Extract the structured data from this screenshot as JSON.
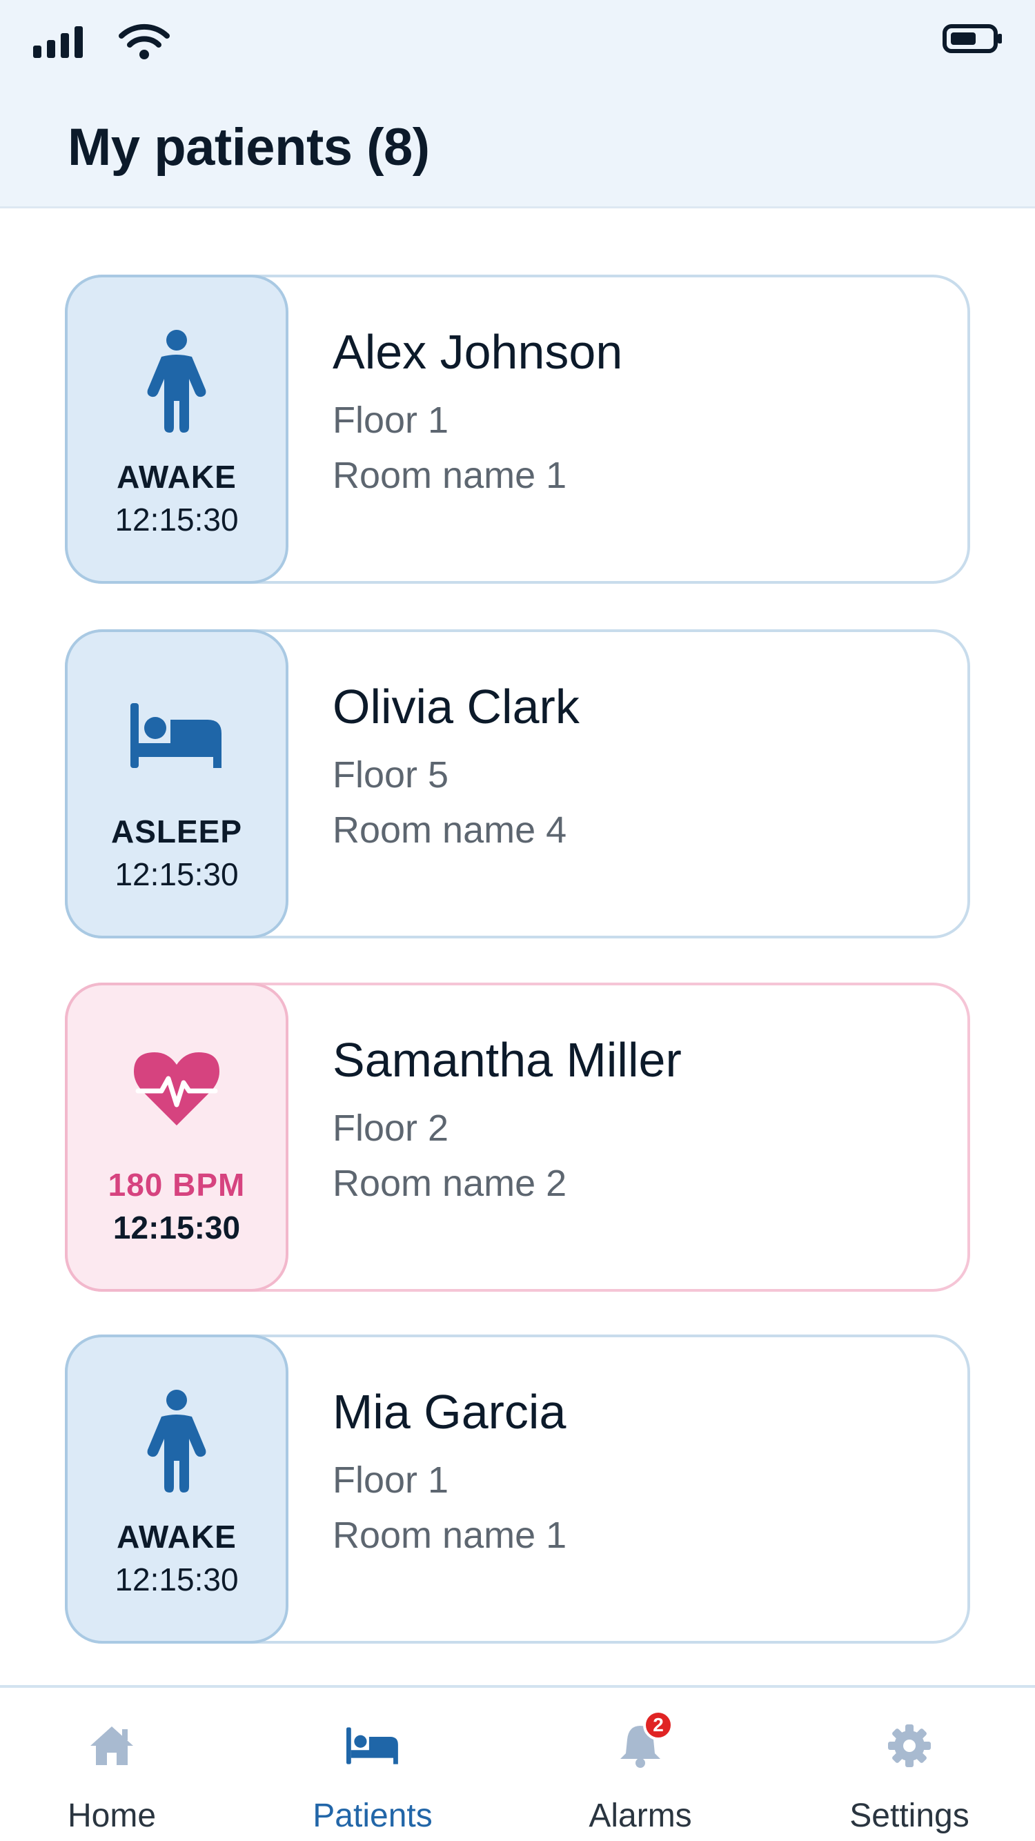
{
  "colors": {
    "header_bg": "#edf4fb",
    "tile_blue": "#dceaf7",
    "tile_pink": "#fce9f0",
    "icon_blue": "#1f66a8",
    "alert_pink": "#d6437f",
    "nav_inactive": "#a8bad0",
    "badge_red": "#e02424"
  },
  "status_bar": {
    "signal": "cellular-signal-icon",
    "wifi": "wifi-icon",
    "battery": "battery-icon"
  },
  "page": {
    "title": "My patients (8)"
  },
  "patients": [
    {
      "name": "Alex Johnson",
      "floor": "Floor 1",
      "room": "Room name 1",
      "status": "AWAKE",
      "time": "12:15:30",
      "icon": "person-icon"
    },
    {
      "name": "Olivia Clark",
      "floor": "Floor 5",
      "room": "Room name 4",
      "status": "ASLEEP",
      "time": "12:15:30",
      "icon": "bed-icon"
    },
    {
      "name": "Samantha Miller",
      "floor": "Floor 2",
      "room": "Room name 2",
      "status": "180 BPM",
      "time": "12:15:30",
      "icon": "heart-pulse-icon"
    },
    {
      "name": "Mia Garcia",
      "floor": "Floor 1",
      "room": "Room name 1",
      "status": "AWAKE",
      "time": "12:15:30",
      "icon": "person-icon"
    }
  ],
  "nav": {
    "items": [
      {
        "label": "Home",
        "icon": "home-icon"
      },
      {
        "label": "Patients",
        "icon": "bed-icon"
      },
      {
        "label": "Alarms",
        "icon": "bell-icon",
        "badge": "2"
      },
      {
        "label": "Settings",
        "icon": "gear-icon"
      }
    ],
    "active": "Patients"
  }
}
